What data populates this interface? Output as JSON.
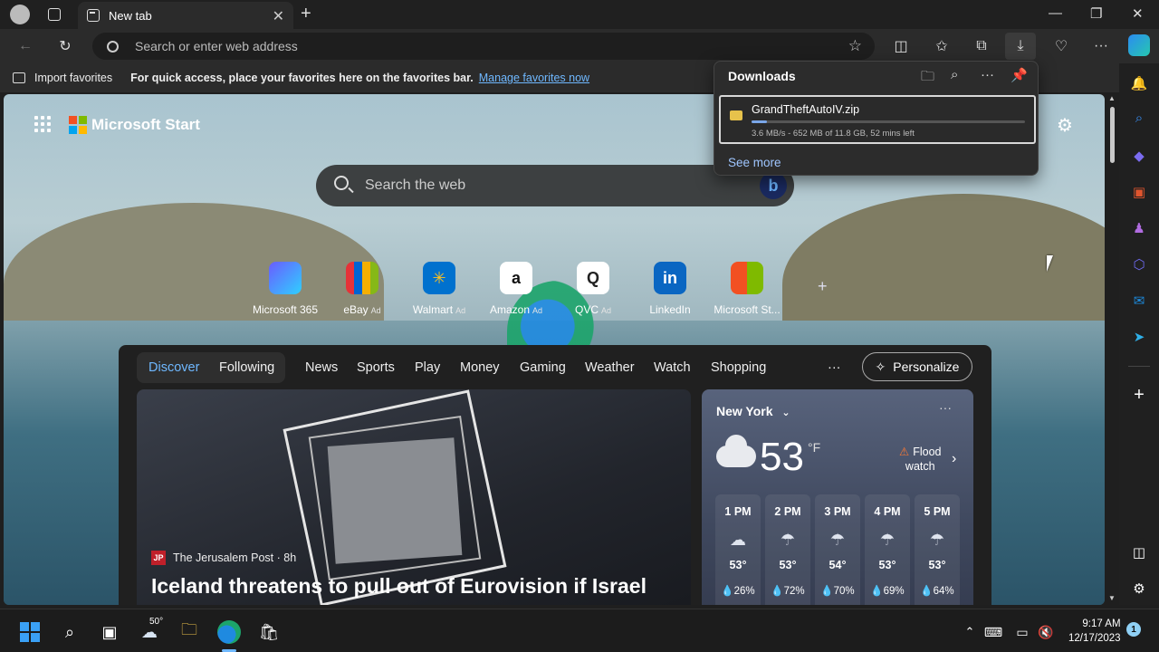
{
  "tab": {
    "title": "New tab"
  },
  "omnibox": {
    "placeholder": "Search or enter web address"
  },
  "favorites_bar": {
    "import_label": "Import favorites",
    "message": "For quick access, place your favorites here on the favorites bar.",
    "manage_link": "Manage favorites now"
  },
  "start": {
    "brand": "Microsoft Start",
    "search_placeholder": "Search the web",
    "quick_links": [
      {
        "label": "Microsoft 365",
        "ad": ""
      },
      {
        "label": "eBay",
        "ad": "Ad"
      },
      {
        "label": "Walmart",
        "ad": "Ad"
      },
      {
        "label": "Amazon",
        "ad": "Ad"
      },
      {
        "label": "QVC",
        "ad": "Ad"
      },
      {
        "label": "LinkedIn",
        "ad": ""
      },
      {
        "label": "Microsoft St...",
        "ad": ""
      }
    ]
  },
  "feed": {
    "tabs": [
      "Discover",
      "Following",
      "News",
      "Sports",
      "Play",
      "Money",
      "Gaming",
      "Weather",
      "Watch",
      "Shopping"
    ],
    "more": "···",
    "personalize": "Personalize",
    "story": {
      "publisher_badge": "JP",
      "publisher": "The Jerusalem Post · 8h",
      "headline": "Iceland threatens to pull out of Eurovision if Israel"
    },
    "weather": {
      "city": "New York",
      "temp": "53",
      "unit": "°F",
      "alert_line1": "Flood",
      "alert_line2": "watch",
      "hours": [
        {
          "time": "1 PM",
          "temp": "53°",
          "precip": "26%"
        },
        {
          "time": "2 PM",
          "temp": "53°",
          "precip": "72%"
        },
        {
          "time": "3 PM",
          "temp": "54°",
          "precip": "70%"
        },
        {
          "time": "4 PM",
          "temp": "53°",
          "precip": "69%"
        },
        {
          "time": "5 PM",
          "temp": "53°",
          "precip": "64%"
        }
      ]
    }
  },
  "downloads": {
    "title": "Downloads",
    "item": {
      "filename": "GrandTheftAutoIV.zip",
      "status": "3.6 MB/s - 652 MB of 11.8 GB, 52 mins left",
      "progress_fraction": 0.055
    },
    "see_more": "See more"
  },
  "taskbar": {
    "weather_temp": "50°",
    "time": "9:17 AM",
    "date": "12/17/2023",
    "notification_count": "1"
  },
  "colors": {
    "accent": "#6fb8ff",
    "download_progress": "#7aa6e8",
    "alert": "#ff7a33"
  }
}
